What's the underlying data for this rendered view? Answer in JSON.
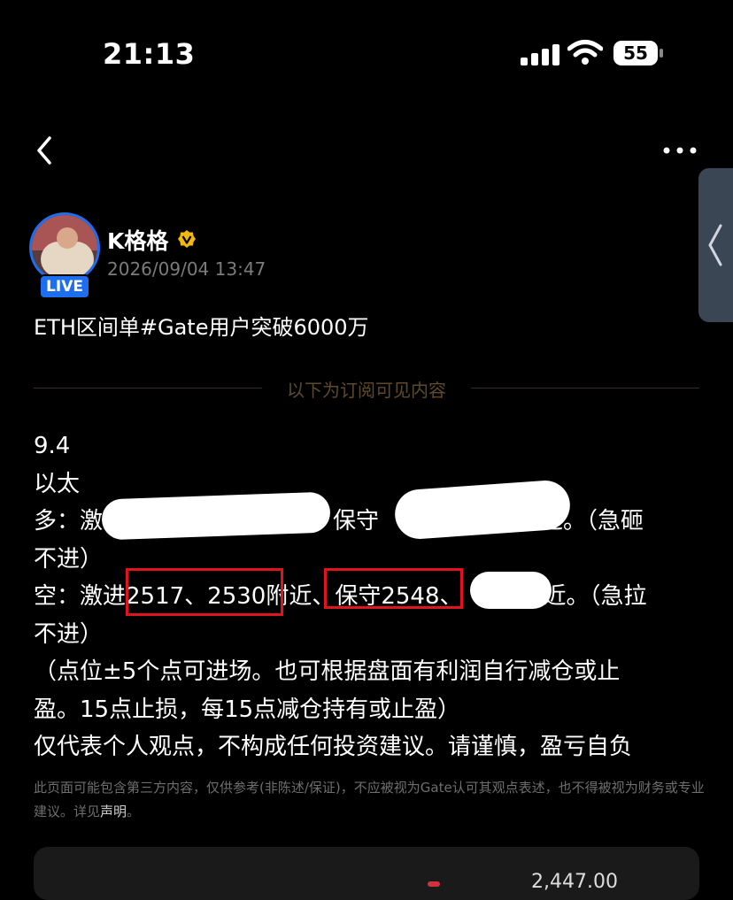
{
  "status_bar": {
    "time": "21:13",
    "battery": "55"
  },
  "nav": {
    "back_icon": "chevron-left-icon",
    "more_icon": "more-horizontal-icon"
  },
  "side_tab": {
    "icon": "chevron-left-icon"
  },
  "author": {
    "name": "K格格",
    "date": "2026/09/04 13:47",
    "live_label": "LIVE",
    "verified_color": "#f0b90b"
  },
  "post": {
    "title": "ETH区间单#Gate用户突破6000万",
    "subscribe_divider": "以下为订阅可见内容",
    "lines": [
      "9.4",
      "以太",
      "多：激　　　　　　　　　。保守　　　　　　　近。（急砸",
      "不进）",
      "空：激进2517、2530附近、保守2548、　　　附近。（急拉",
      "不进）",
      "（点位±5个点可进场。也可根据盘面有利润自行减仓或止",
      "盈。15点止损，每15点减仓持有或止盈）",
      "仅代表个人观点，不构成任何投资建议。请谨慎，盈亏自负"
    ]
  },
  "disclaimer": {
    "text": "此页面可能包含第三方内容，仅供参考(非陈述/保证)，不应被视为Gate认可其观点表述，也不得被视为财务或专业建议。详见",
    "link": "声明",
    "end": "。"
  },
  "bottom_card": {
    "value": "2,447.00"
  },
  "colors": {
    "highlight": "#e0141e",
    "accent_blue": "#1e6ef0",
    "divider_text": "#5e4a2a"
  }
}
